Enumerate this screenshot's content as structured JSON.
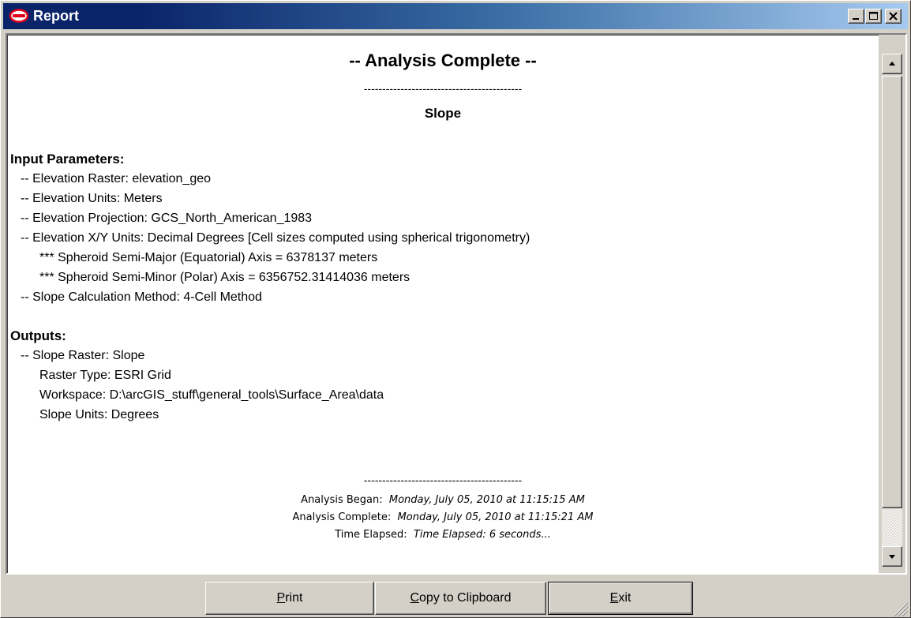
{
  "window": {
    "title": "Report",
    "icon": "report-eye-icon",
    "controls": {
      "minimize": "minimize-icon",
      "maximize": "maximize-icon",
      "close": "close-icon"
    }
  },
  "report": {
    "heading": "-- Analysis Complete --",
    "separator": "-------------------------------------------",
    "subtitle": "Slope",
    "input_section": "Input Parameters:",
    "inputs": [
      "-- Elevation Raster:  elevation_geo",
      "-- Elevation Units:  Meters",
      "-- Elevation Projection:  GCS_North_American_1983",
      "-- Elevation X/Y Units:  Decimal Degrees [Cell sizes computed using spherical trigonometry)",
      "*** Spheroid Semi-Major (Equatorial) Axis = 6378137 meters",
      "*** Spheroid Semi-Minor (Polar) Axis = 6356752.31414036 meters",
      "-- Slope Calculation Method:  4-Cell Method"
    ],
    "output_section": "Outputs:",
    "outputs": [
      "-- Slope Raster:  Slope",
      "Raster Type:  ESRI Grid",
      "Workspace:  D:\\arcGIS_stuff\\general_tools\\Surface_Area\\data",
      "Slope Units:  Degrees"
    ],
    "footer_separator": "-------------------------------------------",
    "began_label": "Analysis Began:",
    "began_value": "Monday, July 05, 2010 at 11:15:15 AM",
    "complete_label": "Analysis Complete:",
    "complete_value": "Monday, July 05, 2010 at 11:15:21 AM",
    "elapsed_label": "Time Elapsed:",
    "elapsed_value": "Time Elapsed: 6 seconds..."
  },
  "buttons": {
    "print": {
      "accel": "P",
      "rest": "rint"
    },
    "copy": {
      "accel": "C",
      "rest": "opy to Clipboard"
    },
    "exit": {
      "accel": "E",
      "rest": "xit"
    }
  },
  "colors": {
    "titlebar_start": "#0a246a",
    "titlebar_end": "#a6caf0",
    "face": "#d4d0c8",
    "icon_red": "#e0001b"
  }
}
